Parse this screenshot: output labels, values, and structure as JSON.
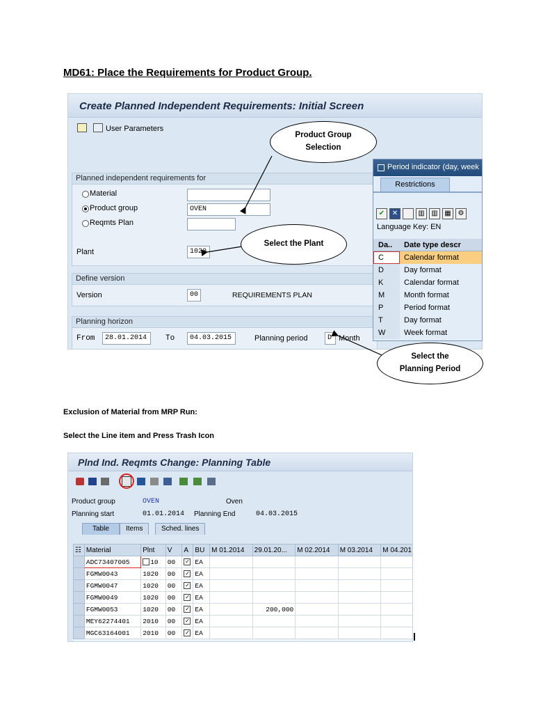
{
  "heading": "MD61: Place the Requirements for Product Group.",
  "screen1": {
    "title": "Create Planned Independent Requirements: Initial Screen",
    "user_parameters": "User Parameters",
    "section_pir": "Planned independent requirements for",
    "opt_material": "Material",
    "opt_product_group": "Product group",
    "opt_reqmts_plan": "Reqmts Plan",
    "product_group_value": "OVEN",
    "plant_label": "Plant",
    "plant_value": "1020",
    "section_version": "Define version",
    "version_label": "Version",
    "version_value": "00",
    "version_desc": "REQUIREMENTS PLAN",
    "section_horizon": "Planning horizon",
    "from_label": "From",
    "from_value": "28.01.2014",
    "to_label": "To",
    "to_value": "04.03.2015",
    "period_label": "Planning period",
    "period_value": "D",
    "period_desc": "Month"
  },
  "popup": {
    "title": "Period indicator (day, week",
    "tab": "Restrictions",
    "lang_key": "Language Key: EN",
    "col_key": "Da..",
    "col_desc": "Date type descr",
    "rows": [
      {
        "key": "C",
        "desc": "Calendar format"
      },
      {
        "key": "D",
        "desc": "Day format"
      },
      {
        "key": "K",
        "desc": "Calendar format"
      },
      {
        "key": "M",
        "desc": "Month format"
      },
      {
        "key": "P",
        "desc": "Period format"
      },
      {
        "key": "T",
        "desc": "Day format"
      },
      {
        "key": "W",
        "desc": "Week format"
      }
    ]
  },
  "callouts": {
    "product_group": "Product Group Selection",
    "plant": "Select the Plant",
    "period": "Select the Planning Period"
  },
  "para1": "Exclusion of Material from MRP Run:",
  "para2": "Select the Line item and Press Trash Icon",
  "screen2": {
    "title": "Plnd Ind. Reqmts Change: Planning Table",
    "product_group_label": "Product group",
    "product_group_value": "OVEN",
    "product_group_desc": "Oven",
    "planning_start_label": "Planning start",
    "planning_start_value": "01.01.2014",
    "planning_end_label": "Planning End",
    "planning_end_value": "04.03.2015",
    "tabs": [
      "Table",
      "Items",
      "Sched. lines"
    ],
    "columns": [
      "Material",
      "Plnt",
      "V",
      "A",
      "BU",
      "M 01.2014",
      "29.01.20...",
      "M 02.2014",
      "M 03.2014",
      "M 04.201"
    ],
    "rows": [
      {
        "material": "ADC73407005",
        "plant": "10",
        "v": "00",
        "bu": "EA",
        "q2": ""
      },
      {
        "material": "FGMW0043",
        "plant": "1020",
        "v": "00",
        "bu": "EA",
        "q2": ""
      },
      {
        "material": "FGMW0047",
        "plant": "1020",
        "v": "00",
        "bu": "EA",
        "q2": ""
      },
      {
        "material": "FGMW0049",
        "plant": "1020",
        "v": "00",
        "bu": "EA",
        "q2": ""
      },
      {
        "material": "FGMW0053",
        "plant": "1020",
        "v": "00",
        "bu": "EA",
        "q2": "200,000"
      },
      {
        "material": "MEY62274401",
        "plant": "2010",
        "v": "00",
        "bu": "EA",
        "q2": ""
      },
      {
        "material": "MGC63164001",
        "plant": "2010",
        "v": "00",
        "bu": "EA",
        "q2": ""
      }
    ]
  }
}
